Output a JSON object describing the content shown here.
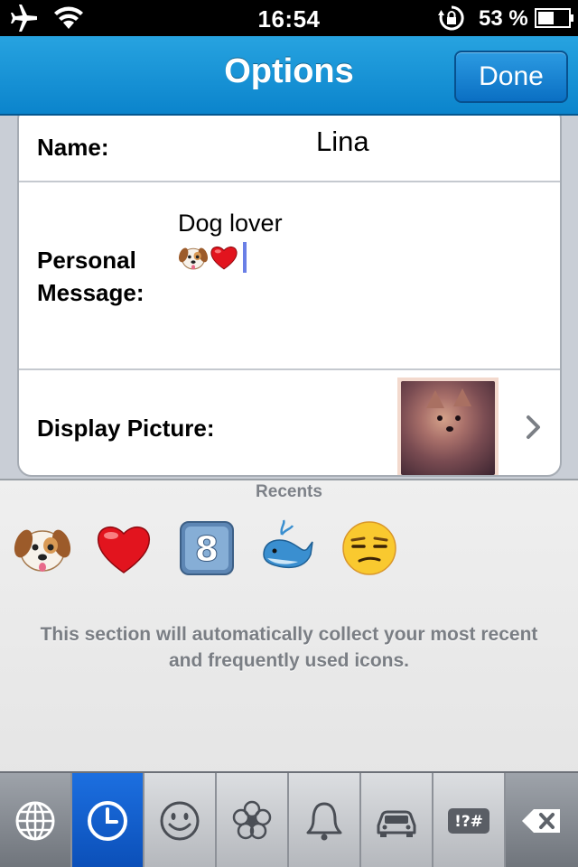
{
  "status_bar": {
    "time": "16:54",
    "battery_percent": "53 %",
    "icons": [
      "airplane-icon",
      "wifi-icon",
      "rotation-lock-icon",
      "battery-icon"
    ]
  },
  "nav": {
    "title": "Options",
    "done_label": "Done"
  },
  "form": {
    "name_label": "Name:",
    "name_value": "Lina",
    "message_label": "Personal Message:",
    "message_text": "Dog lover",
    "message_emojis": [
      "dog-face-emoji",
      "red-heart-emoji"
    ],
    "picture_label": "Display Picture:"
  },
  "keyboard": {
    "section_title": "Recents",
    "recent_emojis": [
      "dog-face-emoji",
      "red-heart-emoji",
      "keycap-8-emoji",
      "whale-emoji",
      "unamused-face-emoji"
    ],
    "info_text": "This section will automatically collect your most recent and frequently used icons.",
    "tabs": [
      "globe",
      "recents-clock",
      "smiley",
      "flower",
      "bell",
      "car",
      "symbols",
      "delete"
    ],
    "active_tab": "recents-clock",
    "symbols_tab_label": "!?#"
  },
  "colors": {
    "nav_blue": "#0b84cc",
    "active_tab_blue": "#0b4fb8",
    "caret": "#6a7fe6"
  }
}
